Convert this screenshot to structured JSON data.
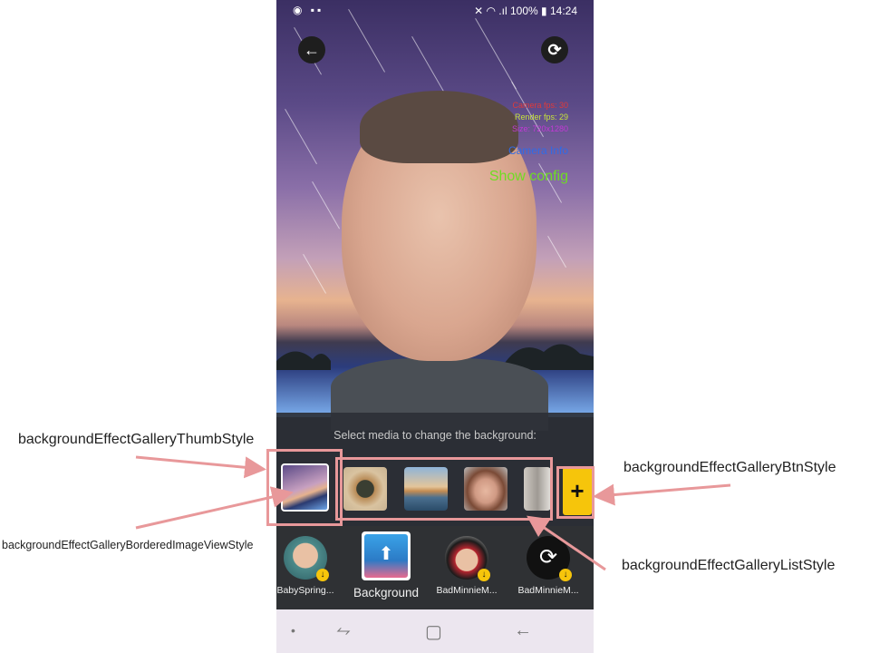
{
  "annotations": {
    "thumb_style": "backgroundEffectGalleryThumbStyle",
    "bordered_image_view_style": "backgroundEffectGalleryBorderedImageViewStyle",
    "btn_style": "backgroundEffectGalleryBtnStyle",
    "list_style": "backgroundEffectGalleryListStyle"
  },
  "status_bar": {
    "battery": "100%",
    "time": "14:24"
  },
  "overlay": {
    "camera_fps": "Camera fps: 30",
    "render_fps": "Render fps: 29",
    "size": "Size: 720x1280",
    "camera_info": "Camera Info",
    "show_config": "Show config"
  },
  "gallery": {
    "prompt": "Select media to change the background:",
    "add_button": "+"
  },
  "effects": [
    {
      "label": "BabySpring...",
      "icon": "baby-spring-icon"
    },
    {
      "label": "Background",
      "icon": "background-gallery-icon"
    },
    {
      "label": "BadMinnieM...",
      "icon": "bad-minnie-icon"
    },
    {
      "label": "BadMinnieM...",
      "icon": "refresh-icon"
    }
  ],
  "colors": {
    "highlight": "#e8989a",
    "accent_yellow": "#f6c50b",
    "fps_camera": "#e03a3a",
    "fps_render": "#c6e33a",
    "size_text": "#c23ad6",
    "camera_info": "#2f6be8",
    "show_config": "#6fdd22"
  }
}
